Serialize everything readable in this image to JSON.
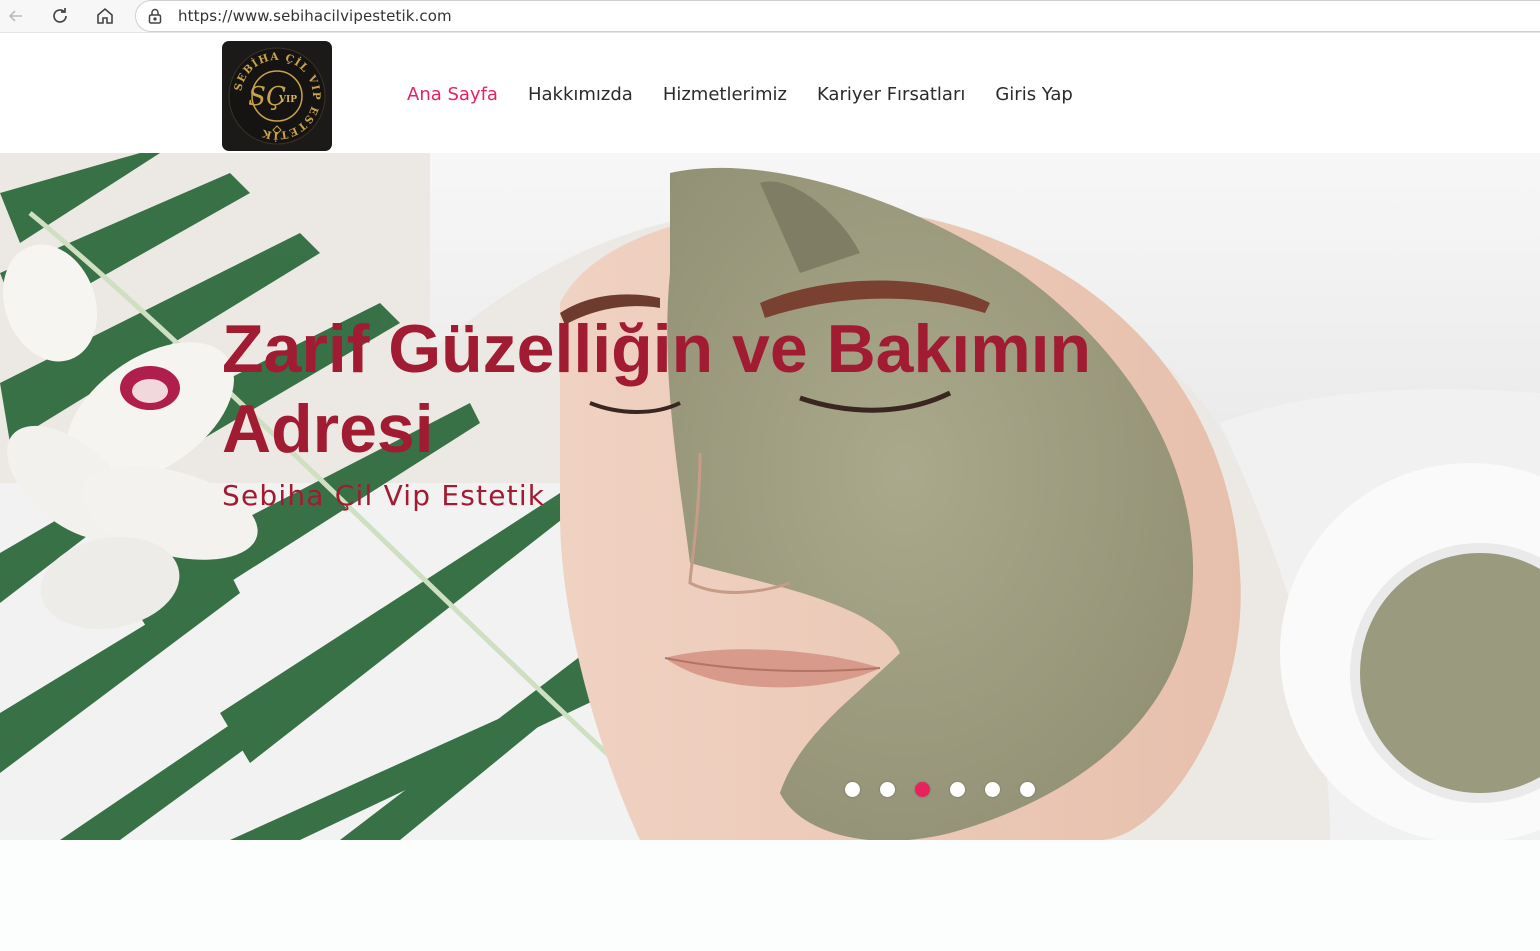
{
  "browser": {
    "url": "https://www.sebihacilvipestetik.com",
    "icons": [
      "back-arrow-icon",
      "reload-icon",
      "home-icon",
      "lock-icon"
    ]
  },
  "header": {
    "logo": {
      "ring_text": "SEBİHA ÇİL VIP ESTETİK",
      "monogram": "SÇ",
      "badge": "VIP"
    },
    "nav": [
      {
        "label": "Ana Sayfa",
        "active": true
      },
      {
        "label": "Hakkımızda",
        "active": false
      },
      {
        "label": "Hizmetlerimiz",
        "active": false
      },
      {
        "label": "Kariyer Fırsatları",
        "active": false
      },
      {
        "label": "Giris Yap",
        "active": false
      }
    ]
  },
  "hero": {
    "title": "Zarif Güzelliğin ve Bakımın Adresi",
    "subtitle": "Sebiha Çil Vip Estetik",
    "slides_count": 6,
    "active_slide_index": 2
  },
  "colors": {
    "accent": "#e8225f",
    "hero_text": "#a11b32",
    "nav_text": "#2b2b2b",
    "logo_gold": "#c9a24a"
  }
}
